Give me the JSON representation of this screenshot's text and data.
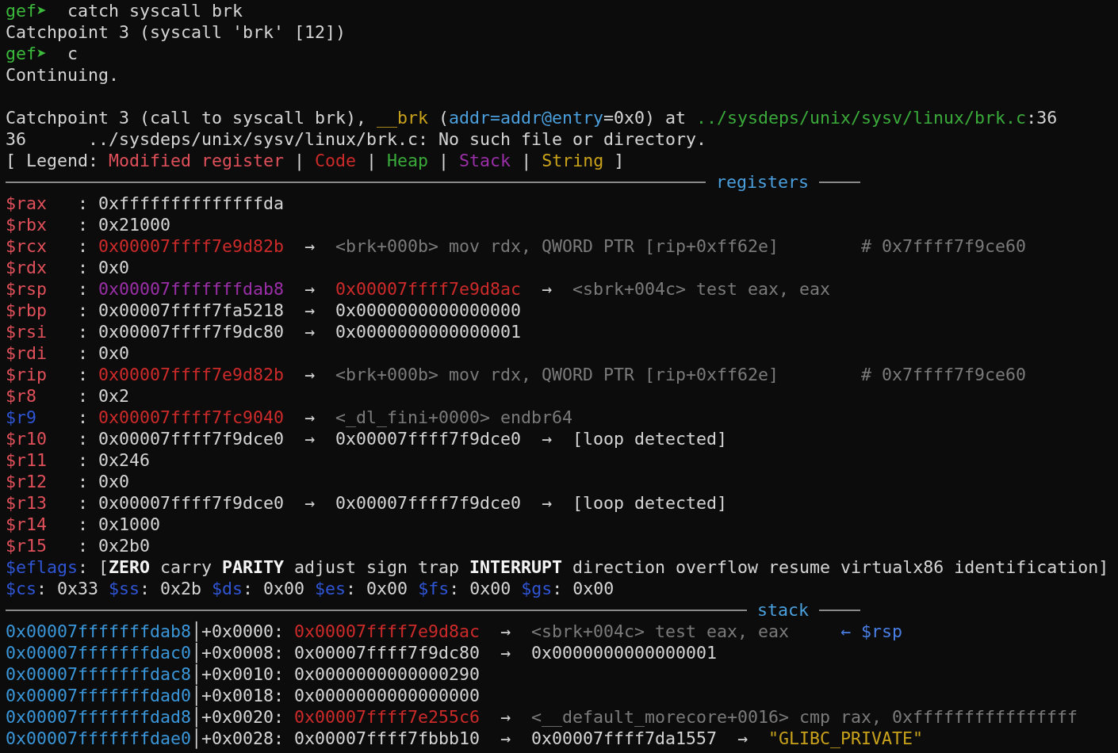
{
  "terminal": {
    "lines": [
      {
        "kind": "command",
        "segments": [
          {
            "kind": "prompt",
            "text": "gef➤"
          },
          {
            "kind": "plain",
            "text": "  catch syscall brk"
          }
        ]
      },
      {
        "kind": "output",
        "segments": [
          {
            "kind": "plain",
            "text": "Catchpoint 3 (syscall 'brk' [12])"
          }
        ]
      },
      {
        "kind": "command",
        "segments": [
          {
            "kind": "prompt",
            "text": "gef➤"
          },
          {
            "kind": "plain",
            "text": "  c"
          }
        ]
      },
      {
        "kind": "output",
        "segments": [
          {
            "kind": "plain",
            "text": "Continuing."
          }
        ]
      },
      {
        "kind": "blank"
      },
      {
        "kind": "output",
        "segments": [
          {
            "kind": "plain",
            "text": "Catchpoint 3 (call to syscall brk), "
          },
          {
            "kind": "func",
            "text": "__brk"
          },
          {
            "kind": "plain",
            "text": " ("
          },
          {
            "kind": "arg",
            "text": "addr=addr@entry"
          },
          {
            "kind": "plain",
            "text": "=0x0) at "
          },
          {
            "kind": "path",
            "text": "../sysdeps/unix/sysv/linux/brk.c"
          },
          {
            "kind": "plain",
            "text": ":36"
          }
        ]
      },
      {
        "kind": "output",
        "segments": [
          {
            "kind": "plain",
            "text": "36      ../sysdeps/unix/sysv/linux/brk.c: No such file or directory."
          }
        ]
      },
      {
        "kind": "output",
        "segments": [
          {
            "kind": "plain",
            "text": "[ Legend: "
          },
          {
            "kind": "modified",
            "text": "Modified register"
          },
          {
            "kind": "plain",
            "text": " | "
          },
          {
            "kind": "code",
            "text": "Code"
          },
          {
            "kind": "plain",
            "text": " | "
          },
          {
            "kind": "heap",
            "text": "Heap"
          },
          {
            "kind": "plain",
            "text": " | "
          },
          {
            "kind": "stack",
            "text": "Stack"
          },
          {
            "kind": "plain",
            "text": " | "
          },
          {
            "kind": "string",
            "text": "String"
          },
          {
            "kind": "plain",
            "text": " ]"
          }
        ]
      },
      {
        "kind": "rule",
        "title": "registers"
      },
      {
        "kind": "register",
        "segments": [
          {
            "kind": "reg",
            "text": "$rax"
          },
          {
            "kind": "plain",
            "text": "   : 0xffffffffffffffda"
          }
        ]
      },
      {
        "kind": "register",
        "segments": [
          {
            "kind": "reg",
            "text": "$rbx"
          },
          {
            "kind": "plain",
            "text": "   : 0x21000"
          }
        ]
      },
      {
        "kind": "register",
        "segments": [
          {
            "kind": "reg",
            "text": "$rcx"
          },
          {
            "kind": "plain",
            "text": "   : "
          },
          {
            "kind": "code",
            "text": "0x00007ffff7e9d82b"
          },
          {
            "kind": "plain",
            "text": "  →  "
          },
          {
            "kind": "dim",
            "text": "<brk+000b> mov rdx, QWORD PTR [rip+0xff62e]        # 0x7ffff7f9ce60"
          }
        ]
      },
      {
        "kind": "register",
        "segments": [
          {
            "kind": "reg",
            "text": "$rdx"
          },
          {
            "kind": "plain",
            "text": "   : 0x0"
          }
        ]
      },
      {
        "kind": "register",
        "segments": [
          {
            "kind": "reg",
            "text": "$rsp"
          },
          {
            "kind": "plain",
            "text": "   : "
          },
          {
            "kind": "stack",
            "text": "0x00007fffffffdab8"
          },
          {
            "kind": "plain",
            "text": "  →  "
          },
          {
            "kind": "code",
            "text": "0x00007ffff7e9d8ac"
          },
          {
            "kind": "plain",
            "text": "  →  "
          },
          {
            "kind": "dim",
            "text": "<sbrk+004c> test eax, eax"
          }
        ]
      },
      {
        "kind": "register",
        "segments": [
          {
            "kind": "reg",
            "text": "$rbp"
          },
          {
            "kind": "plain",
            "text": "   : 0x00007ffff7fa5218  →  0x0000000000000000"
          }
        ]
      },
      {
        "kind": "register",
        "segments": [
          {
            "kind": "reg",
            "text": "$rsi"
          },
          {
            "kind": "plain",
            "text": "   : 0x00007ffff7f9dc80  →  0x0000000000000001"
          }
        ]
      },
      {
        "kind": "register",
        "segments": [
          {
            "kind": "reg",
            "text": "$rdi"
          },
          {
            "kind": "plain",
            "text": "   : 0x0"
          }
        ]
      },
      {
        "kind": "register",
        "segments": [
          {
            "kind": "reg",
            "text": "$rip"
          },
          {
            "kind": "plain",
            "text": "   : "
          },
          {
            "kind": "code",
            "text": "0x00007ffff7e9d82b"
          },
          {
            "kind": "plain",
            "text": "  →  "
          },
          {
            "kind": "dim",
            "text": "<brk+000b> mov rdx, QWORD PTR [rip+0xff62e]        # 0x7ffff7f9ce60"
          }
        ]
      },
      {
        "kind": "register",
        "segments": [
          {
            "kind": "reg",
            "text": "$r8"
          },
          {
            "kind": "plain",
            "text": "    : 0x2"
          }
        ]
      },
      {
        "kind": "register",
        "segments": [
          {
            "kind": "regblue",
            "text": "$r9"
          },
          {
            "kind": "plain",
            "text": "    : "
          },
          {
            "kind": "code",
            "text": "0x00007ffff7fc9040"
          },
          {
            "kind": "plain",
            "text": "  →  "
          },
          {
            "kind": "dim",
            "text": "<_dl_fini+0000> endbr64"
          }
        ]
      },
      {
        "kind": "register",
        "segments": [
          {
            "kind": "reg",
            "text": "$r10"
          },
          {
            "kind": "plain",
            "text": "   : 0x00007ffff7f9dce0  →  0x00007ffff7f9dce0  →  [loop detected]"
          }
        ]
      },
      {
        "kind": "register",
        "segments": [
          {
            "kind": "reg",
            "text": "$r11"
          },
          {
            "kind": "plain",
            "text": "   : 0x246"
          }
        ]
      },
      {
        "kind": "register",
        "segments": [
          {
            "kind": "reg",
            "text": "$r12"
          },
          {
            "kind": "plain",
            "text": "   : 0x0"
          }
        ]
      },
      {
        "kind": "register",
        "segments": [
          {
            "kind": "reg",
            "text": "$r13"
          },
          {
            "kind": "plain",
            "text": "   : 0x00007ffff7f9dce0  →  0x00007ffff7f9dce0  →  [loop detected]"
          }
        ]
      },
      {
        "kind": "register",
        "segments": [
          {
            "kind": "reg",
            "text": "$r14"
          },
          {
            "kind": "plain",
            "text": "   : 0x1000"
          }
        ]
      },
      {
        "kind": "register",
        "segments": [
          {
            "kind": "reg",
            "text": "$r15"
          },
          {
            "kind": "plain",
            "text": "   : 0x2b0"
          }
        ]
      },
      {
        "kind": "register",
        "segments": [
          {
            "kind": "regblue",
            "text": "$eflags"
          },
          {
            "kind": "plain",
            "text": ": ["
          },
          {
            "kind": "bold",
            "text": "ZERO"
          },
          {
            "kind": "plain",
            "text": " carry "
          },
          {
            "kind": "bold",
            "text": "PARITY"
          },
          {
            "kind": "plain",
            "text": " adjust sign trap "
          },
          {
            "kind": "bold",
            "text": "INTERRUPT"
          },
          {
            "kind": "plain",
            "text": " direction overflow resume virtualx86 identification]"
          }
        ]
      },
      {
        "kind": "register",
        "segments": [
          {
            "kind": "regblue",
            "text": "$cs"
          },
          {
            "kind": "plain",
            "text": ": 0x33 "
          },
          {
            "kind": "regblue",
            "text": "$ss"
          },
          {
            "kind": "plain",
            "text": ": 0x2b "
          },
          {
            "kind": "regblue",
            "text": "$ds"
          },
          {
            "kind": "plain",
            "text": ": 0x00 "
          },
          {
            "kind": "regblue",
            "text": "$es"
          },
          {
            "kind": "plain",
            "text": ": 0x00 "
          },
          {
            "kind": "regblue",
            "text": "$fs"
          },
          {
            "kind": "plain",
            "text": ": 0x00 "
          },
          {
            "kind": "regblue",
            "text": "$gs"
          },
          {
            "kind": "plain",
            "text": ": 0x00"
          }
        ]
      },
      {
        "kind": "rule",
        "title": "stack"
      },
      {
        "kind": "stack",
        "segments": [
          {
            "kind": "addr",
            "text": "0x00007fffffffdab8"
          },
          {
            "kind": "plain",
            "text": "│+0x0000: "
          },
          {
            "kind": "code",
            "text": "0x00007ffff7e9d8ac"
          },
          {
            "kind": "plain",
            "text": "  →  "
          },
          {
            "kind": "dim",
            "text": "<sbrk+004c> test eax, eax"
          },
          {
            "kind": "pointer",
            "text": "← $rsp"
          }
        ]
      },
      {
        "kind": "stack",
        "segments": [
          {
            "kind": "addr",
            "text": "0x00007fffffffdac0"
          },
          {
            "kind": "plain",
            "text": "│+0x0008: 0x00007ffff7f9dc80  →  0x0000000000000001"
          }
        ]
      },
      {
        "kind": "stack",
        "segments": [
          {
            "kind": "addr",
            "text": "0x00007fffffffdac8"
          },
          {
            "kind": "plain",
            "text": "│+0x0010: 0x0000000000000290"
          }
        ]
      },
      {
        "kind": "stack",
        "segments": [
          {
            "kind": "addr",
            "text": "0x00007fffffffdad0"
          },
          {
            "kind": "plain",
            "text": "│+0x0018: 0x0000000000000000"
          }
        ]
      },
      {
        "kind": "stack",
        "segments": [
          {
            "kind": "addr",
            "text": "0x00007fffffffdad8"
          },
          {
            "kind": "plain",
            "text": "│+0x0020: "
          },
          {
            "kind": "code",
            "text": "0x00007ffff7e255c6"
          },
          {
            "kind": "plain",
            "text": "  →  "
          },
          {
            "kind": "dim",
            "text": "<__default_morecore+0016> cmp rax, 0xffffffffffffffff"
          }
        ]
      },
      {
        "kind": "stack",
        "segments": [
          {
            "kind": "addr",
            "text": "0x00007fffffffdae0"
          },
          {
            "kind": "plain",
            "text": "│+0x0028: 0x00007ffff7fbbb10  →  0x00007ffff7da1557  →  "
          },
          {
            "kind": "string",
            "text": "\"GLIBC_PRIVATE\""
          }
        ]
      }
    ]
  }
}
